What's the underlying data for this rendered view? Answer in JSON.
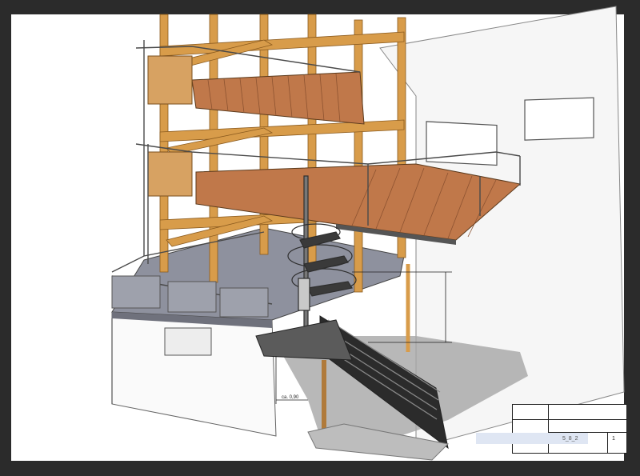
{
  "viewer": {
    "background": "#2b2b2b",
    "sheet_color": "#ffffff"
  },
  "drawing": {
    "subject": "timber frame tower with spiral staircase, straight steel stair and cantilevered decks",
    "dimension_label": "ca. 0,90",
    "colors": {
      "timber": "#d89c4a",
      "deck": "#c0784a",
      "steel": "#5b5b5b",
      "slab": "#8e919e",
      "wall": "#f3f3f3",
      "shadow": "#9a9a9a"
    }
  },
  "title_block": {
    "drawing_number": "5_8_2",
    "sheet_number": "1"
  }
}
